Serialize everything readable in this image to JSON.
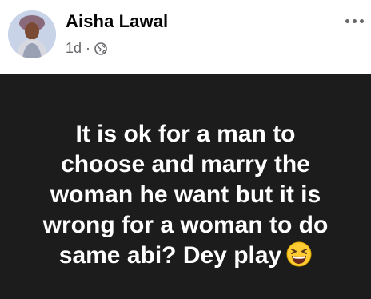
{
  "post": {
    "author": "Aisha Lawal",
    "time": "1d",
    "separator": "·",
    "audience_icon": "globe-icon",
    "menu_icon": "more-options-icon",
    "text": "It is ok for a man to\nchoose and marry the\nwoman he want but it is\nwrong for a woman to do\nsame abi? Dey play",
    "emoji": "grinning-squinting-face-emoji",
    "colors": {
      "header_bg": "#ffffff",
      "body_bg": "#1c1c1c",
      "post_text": "#ffffff",
      "meta_text": "#65676b",
      "emoji_yellow": "#ffcc33"
    }
  }
}
